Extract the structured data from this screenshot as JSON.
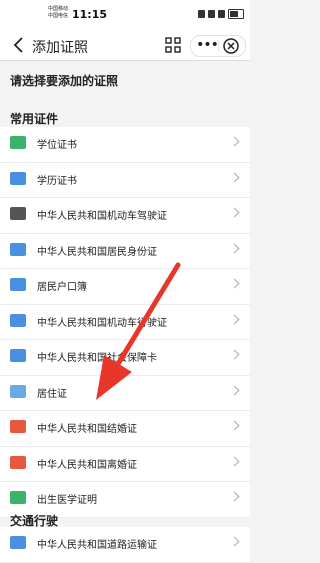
{
  "status_bar": {
    "carrier_1": "中国移动",
    "carrier_2": "中国电信",
    "time": "11:15"
  },
  "nav": {
    "title": "添加证照",
    "more_label": "•••"
  },
  "prompt": "请选择要添加的证照",
  "sections": [
    {
      "title": "常用证件",
      "items": [
        {
          "label": "学位证书",
          "icon": "degree-certificate-icon",
          "color": "#3bb36b"
        },
        {
          "label": "学历证书",
          "icon": "graduation-cap-icon",
          "color": "#4a90e2"
        },
        {
          "label": "中华人民共和国机动车驾驶证",
          "icon": "driver-license-icon",
          "color": "#555555"
        },
        {
          "label": "中华人民共和国居民身份证",
          "icon": "id-card-icon",
          "color": "#4a90e2"
        },
        {
          "label": "居民户口簿",
          "icon": "household-register-icon",
          "color": "#4a90e2"
        },
        {
          "label": "中华人民共和国机动车行驶证",
          "icon": "vehicle-license-icon",
          "color": "#4a90e2"
        },
        {
          "label": "中华人民共和国社会保障卡",
          "icon": "social-security-card-icon",
          "color": "#4a90e2"
        },
        {
          "label": "居住证",
          "icon": "residence-permit-icon",
          "color": "#6aa8e6"
        },
        {
          "label": "中华人民共和国结婚证",
          "icon": "marriage-certificate-icon",
          "color": "#e8573f"
        },
        {
          "label": "中华人民共和国离婚证",
          "icon": "divorce-certificate-icon",
          "color": "#e8573f"
        },
        {
          "label": "出生医学证明",
          "icon": "birth-certificate-icon",
          "color": "#3bb36b"
        }
      ]
    },
    {
      "title": "交通行驶",
      "items": [
        {
          "label": "中华人民共和国道路运输证",
          "icon": "road-transport-icon",
          "color": "#4a90e2"
        }
      ]
    }
  ],
  "annotation_arrow_color": "#e8362b"
}
